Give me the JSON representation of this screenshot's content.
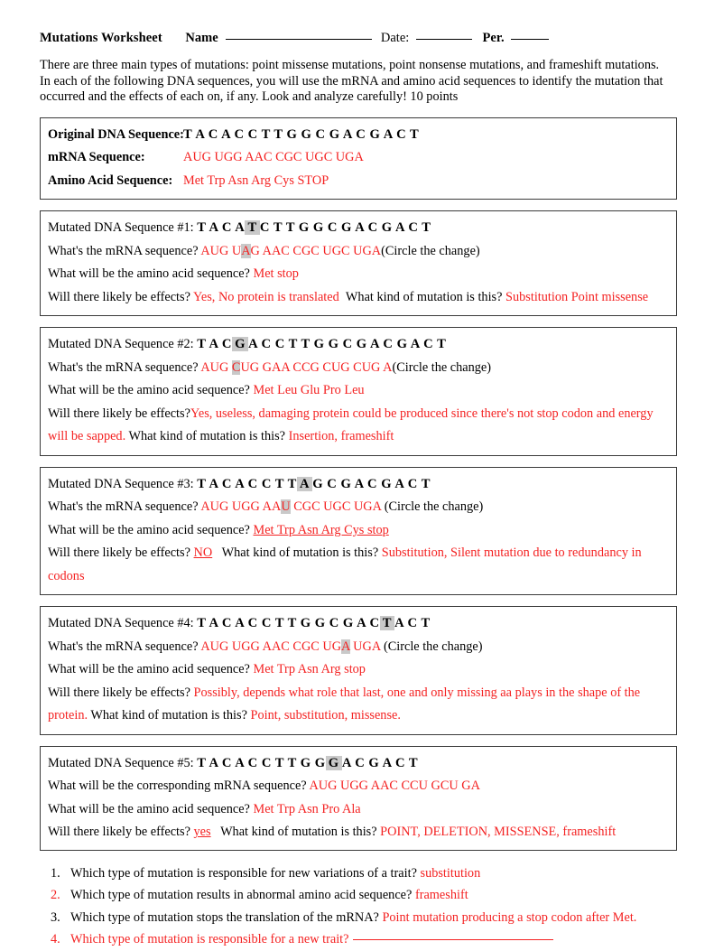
{
  "header": {
    "title": "Mutations Worksheet",
    "name_label": "Name",
    "date_label": "Date:",
    "per_label": "Per."
  },
  "intro": "There are three main types of mutations: point missense mutations, point nonsense mutations, and frameshift mutations. In each of the following DNA sequences, you will use the mRNA and amino acid sequences to identify the mutation that occurred and the effects of each on, if any.  Look and analyze carefully! 10 points",
  "original": {
    "dna_label": "Original DNA Sequence:",
    "dna_sequence": "T A C A C C T T G G C G A C G A C T",
    "mrna_label": "mRNA Sequence:",
    "mrna_sequence": "AUG UGG AAC CGC UGC UGA",
    "aa_label": "Amino Acid Sequence:",
    "aa_sequence": "Met Trp Asn Arg Cys STOP"
  },
  "prompts": {
    "mrna_question": "What's the mRNA sequence?",
    "mrna_question_5": "What will be the corresponding mRNA sequence?",
    "aa_question": "What will be the amino acid sequence?",
    "effects_question": "Will there likely be effects?",
    "kind_question": "What kind of mutation is this?",
    "circle_note": "(Circle the change)"
  },
  "mutations": [
    {
      "label": "Mutated DNA Sequence #1:",
      "dna_pre": "T A C A",
      "dna_hl": "T",
      "dna_post": "C T T G G C G A C G A C T",
      "mrna_pre": "AUG U",
      "mrna_hl": "A",
      "mrna_post": "G AAC CGC UGC UGA",
      "amino_acid": "Met stop",
      "effects": "Yes, No protein is translated",
      "kind": "Substitution Point missense"
    },
    {
      "label": "Mutated DNA Sequence #2:",
      "dna_pre": "T A C",
      "dna_hl": "G",
      "dna_post": "A C C T T G G C G A C G A C T",
      "mrna_pre": "AUG ",
      "mrna_hl": "C",
      "mrna_post": "UG GAA CCG CUG CUG A",
      "amino_acid": "Met Leu Glu Pro Leu",
      "effects": "Yes,  useless, damaging protein could be produced since there's not stop codon and energy will be sapped.",
      "kind": "Insertion, frameshift"
    },
    {
      "label": "Mutated DNA Sequence #3:",
      "dna_pre": "T A C A C C T T",
      "dna_hl": "A",
      "dna_post": "G C G A C G A C T",
      "mrna_pre": "AUG UGG AA",
      "mrna_hl": "U",
      "mrna_post": " CGC UGC UGA ",
      "amino_acid": "Met Trp Asn Arg Cys stop",
      "effects": "NO",
      "kind": "Substitution, Silent mutation due to redundancy in codons"
    },
    {
      "label": "Mutated DNA Sequence #4:",
      "dna_pre": "T A C A C C T T G G C G A C",
      "dna_hl": "T",
      "dna_post": "A C T",
      "mrna_pre": "AUG UGG AAC CGC UG",
      "mrna_hl": "A",
      "mrna_post": " UGA ",
      "amino_acid": "Met Trp Asn Arg stop",
      "effects": "Possibly, depends what role that last, one and only missing aa plays in the shape of the protein.",
      "kind": "Point, substitution, missense."
    },
    {
      "label": "Mutated DNA Sequence #5:",
      "dna_pre": "T A C A C C T T G G",
      "dna_hl": "G",
      "dna_post": "A C G A C T",
      "mrna_pre": "AUG UGG AAC CCU GCU GA",
      "mrna_hl": "",
      "mrna_post": "",
      "amino_acid": "Met Trp Asn Pro Ala",
      "effects": "yes",
      "kind": "POINT, DELETION, MISSENSE, frameshift"
    }
  ],
  "questions": [
    {
      "num": "1.",
      "text": "Which type of mutation is responsible for new variations of a trait?",
      "answer": "substitution"
    },
    {
      "num": "2.",
      "text": "Which type of mutation results in abnormal amino acid sequence?",
      "answer": "frameshift"
    },
    {
      "num": "3.",
      "text": "Which type of mutation stops the translation of the mRNA?",
      "answer": "Point mutation producing a stop codon after Met."
    },
    {
      "num": "4.",
      "text": "Which type of mutation is responsible for a new trait?",
      "answer": ""
    }
  ],
  "colors": {
    "answer_red": "#f42222",
    "highlight_gray": "#c9c9c9"
  }
}
